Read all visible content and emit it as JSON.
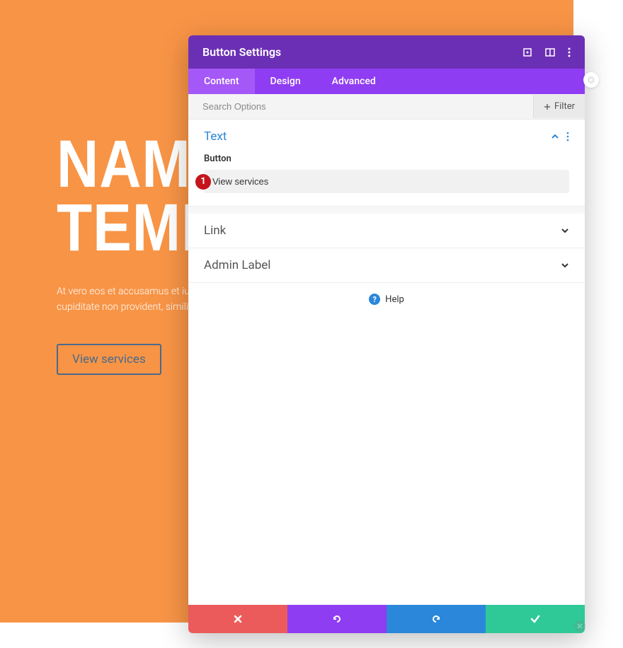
{
  "colors": {
    "accent": "#f89446",
    "primary": "#8f3df2",
    "primaryDark": "#6b2fb5",
    "link": "#2b87da",
    "badge": "#c4151c",
    "success": "#2fc998"
  },
  "hero": {
    "title_line1": "NAM",
    "title_line2": "TEMP",
    "paragraph": "At vero eos et accusamus et iusto voluptatum deleniti atque corrupti cupiditate non provident, similique laborum et dolorum fuga. Et harum",
    "button_label": "View services"
  },
  "modal": {
    "title": "Button Settings",
    "header_icons": [
      "expand-icon",
      "columns-icon",
      "more-icon"
    ],
    "tabs": [
      {
        "label": "Content",
        "active": true
      },
      {
        "label": "Design",
        "active": false
      },
      {
        "label": "Advanced",
        "active": false
      }
    ],
    "search": {
      "placeholder": "Search Options"
    },
    "filter_label": "Filter",
    "sections": {
      "text": {
        "title": "Text",
        "open": true,
        "field_label": "Button",
        "field_value": "View services",
        "badge": "1"
      },
      "link": {
        "title": "Link",
        "open": false
      },
      "admin_label": {
        "title": "Admin Label",
        "open": false
      }
    },
    "help_label": "Help",
    "footer_icons": [
      "cancel-icon",
      "undo-icon",
      "redo-icon",
      "save-icon"
    ]
  }
}
